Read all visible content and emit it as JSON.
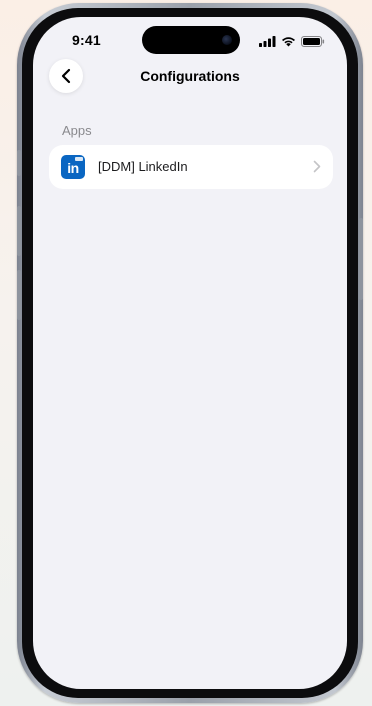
{
  "status_bar": {
    "time": "9:41",
    "icons": [
      "signal-icon",
      "wifi-icon",
      "battery-icon"
    ]
  },
  "nav": {
    "back_icon": "chevron-left-icon",
    "title": "Configurations"
  },
  "section": {
    "header": "Apps"
  },
  "apps": [
    {
      "icon": "linkedin-icon",
      "icon_text": "in",
      "label": "[DDM] LinkedIn",
      "trailing_icon": "chevron-right-icon"
    }
  ],
  "colors": {
    "screen_background": "#f2f2f7",
    "card_background": "#ffffff",
    "linkedin_blue": "#0a66c2",
    "section_header": "#8a8a8e",
    "chevron": "#c4c4c7"
  }
}
